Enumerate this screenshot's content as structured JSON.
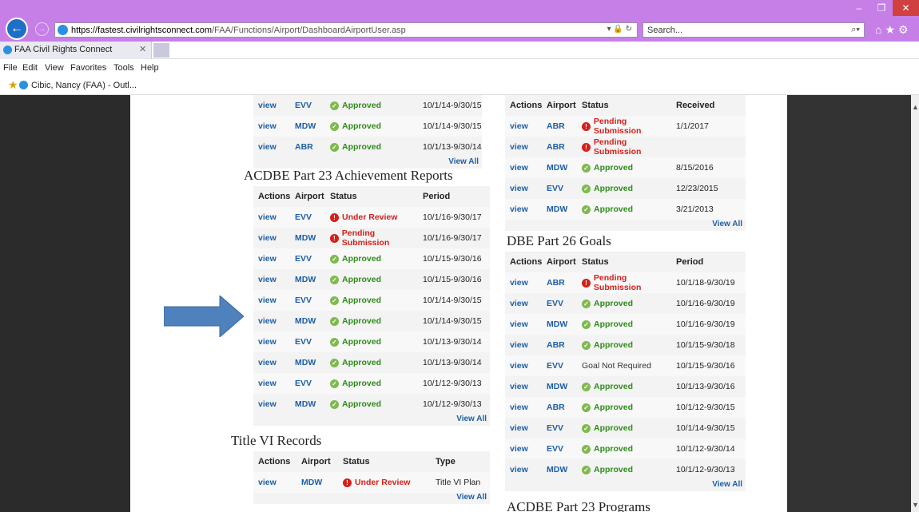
{
  "browser": {
    "url_host": "https://fastest.civilrightsconnect.com",
    "url_path": "/FAA/Functions/Airport/DashboardAirportUser.asp",
    "search_placeholder": "Search...",
    "tab_title": "FAA Civil Rights Connect",
    "menu": [
      "File",
      "Edit",
      "View",
      "Favorites",
      "Tools",
      "Help"
    ],
    "favorite": "Cibic, Nancy (FAA) - Outl..."
  },
  "colors": {
    "titlebar": "#c77fe8",
    "link": "#1d5ea5",
    "approved": "#2e8b1a",
    "pending": "#d4201b"
  },
  "left_top_rows": [
    {
      "action": "view",
      "airport": "EVV",
      "status": "Approved",
      "period": "10/1/14-9/30/15"
    },
    {
      "action": "view",
      "airport": "MDW",
      "status": "Approved",
      "period": "10/1/14-9/30/15"
    },
    {
      "action": "view",
      "airport": "ABR",
      "status": "Approved",
      "period": "10/1/13-9/30/14"
    }
  ],
  "view_all": "View All",
  "acdbe_achievement": {
    "title": "ACDBE Part 23 Achievement Reports",
    "headers": [
      "Actions",
      "Airport",
      "Status",
      "Period"
    ],
    "rows": [
      {
        "action": "view",
        "airport": "EVV",
        "status": "Under Review",
        "kind": "warn",
        "period": "10/1/16-9/30/17"
      },
      {
        "action": "view",
        "airport": "MDW",
        "status": "Pending Submission",
        "kind": "warn",
        "period": "10/1/16-9/30/17"
      },
      {
        "action": "view",
        "airport": "EVV",
        "status": "Approved",
        "kind": "ok",
        "period": "10/1/15-9/30/16"
      },
      {
        "action": "view",
        "airport": "MDW",
        "status": "Approved",
        "kind": "ok",
        "period": "10/1/15-9/30/16"
      },
      {
        "action": "view",
        "airport": "EVV",
        "status": "Approved",
        "kind": "ok",
        "period": "10/1/14-9/30/15"
      },
      {
        "action": "view",
        "airport": "MDW",
        "status": "Approved",
        "kind": "ok",
        "period": "10/1/14-9/30/15"
      },
      {
        "action": "view",
        "airport": "EVV",
        "status": "Approved",
        "kind": "ok",
        "period": "10/1/13-9/30/14"
      },
      {
        "action": "view",
        "airport": "MDW",
        "status": "Approved",
        "kind": "ok",
        "period": "10/1/13-9/30/14"
      },
      {
        "action": "view",
        "airport": "EVV",
        "status": "Approved",
        "kind": "ok",
        "period": "10/1/12-9/30/13"
      },
      {
        "action": "view",
        "airport": "MDW",
        "status": "Approved",
        "kind": "ok",
        "period": "10/1/12-9/30/13"
      }
    ]
  },
  "title_vi": {
    "title": "Title VI Records",
    "headers": [
      "Actions",
      "Airport",
      "Status",
      "Type"
    ],
    "rows": [
      {
        "action": "view",
        "airport": "MDW",
        "status": "Under Review",
        "kind": "warn",
        "type": "Title VI Plan"
      }
    ]
  },
  "right_top": {
    "headers": [
      "Actions",
      "Airport",
      "Status",
      "Received"
    ],
    "rows": [
      {
        "action": "view",
        "airport": "ABR",
        "status": "Pending Submission",
        "kind": "warn",
        "received": "1/1/2017"
      },
      {
        "action": "view",
        "airport": "ABR",
        "status": "Pending Submission",
        "kind": "warn",
        "received": ""
      },
      {
        "action": "view",
        "airport": "MDW",
        "status": "Approved",
        "kind": "ok",
        "received": "8/15/2016"
      },
      {
        "action": "view",
        "airport": "EVV",
        "status": "Approved",
        "kind": "ok",
        "received": "12/23/2015"
      },
      {
        "action": "view",
        "airport": "MDW",
        "status": "Approved",
        "kind": "ok",
        "received": "3/21/2013"
      }
    ]
  },
  "dbe_goals": {
    "title": "DBE Part 26 Goals",
    "headers": [
      "Actions",
      "Airport",
      "Status",
      "Period"
    ],
    "rows": [
      {
        "action": "view",
        "airport": "ABR",
        "status": "Pending Submission",
        "kind": "warn",
        "period": "10/1/18-9/30/19"
      },
      {
        "action": "view",
        "airport": "EVV",
        "status": "Approved",
        "kind": "ok",
        "period": "10/1/16-9/30/19"
      },
      {
        "action": "view",
        "airport": "MDW",
        "status": "Approved",
        "kind": "ok",
        "period": "10/1/16-9/30/19"
      },
      {
        "action": "view",
        "airport": "ABR",
        "status": "Approved",
        "kind": "ok",
        "period": "10/1/15-9/30/18"
      },
      {
        "action": "view",
        "airport": "EVV",
        "status": "Goal Not Required",
        "kind": "plain",
        "period": "10/1/15-9/30/16"
      },
      {
        "action": "view",
        "airport": "MDW",
        "status": "Approved",
        "kind": "ok",
        "period": "10/1/13-9/30/16"
      },
      {
        "action": "view",
        "airport": "ABR",
        "status": "Approved",
        "kind": "ok",
        "period": "10/1/12-9/30/15"
      },
      {
        "action": "view",
        "airport": "EVV",
        "status": "Approved",
        "kind": "ok",
        "period": "10/1/14-9/30/15"
      },
      {
        "action": "view",
        "airport": "EVV",
        "status": "Approved",
        "kind": "ok",
        "period": "10/1/12-9/30/14"
      },
      {
        "action": "view",
        "airport": "MDW",
        "status": "Approved",
        "kind": "ok",
        "period": "10/1/12-9/30/13"
      }
    ]
  },
  "acdbe_programs": {
    "title": "ACDBE Part 23 Programs"
  }
}
